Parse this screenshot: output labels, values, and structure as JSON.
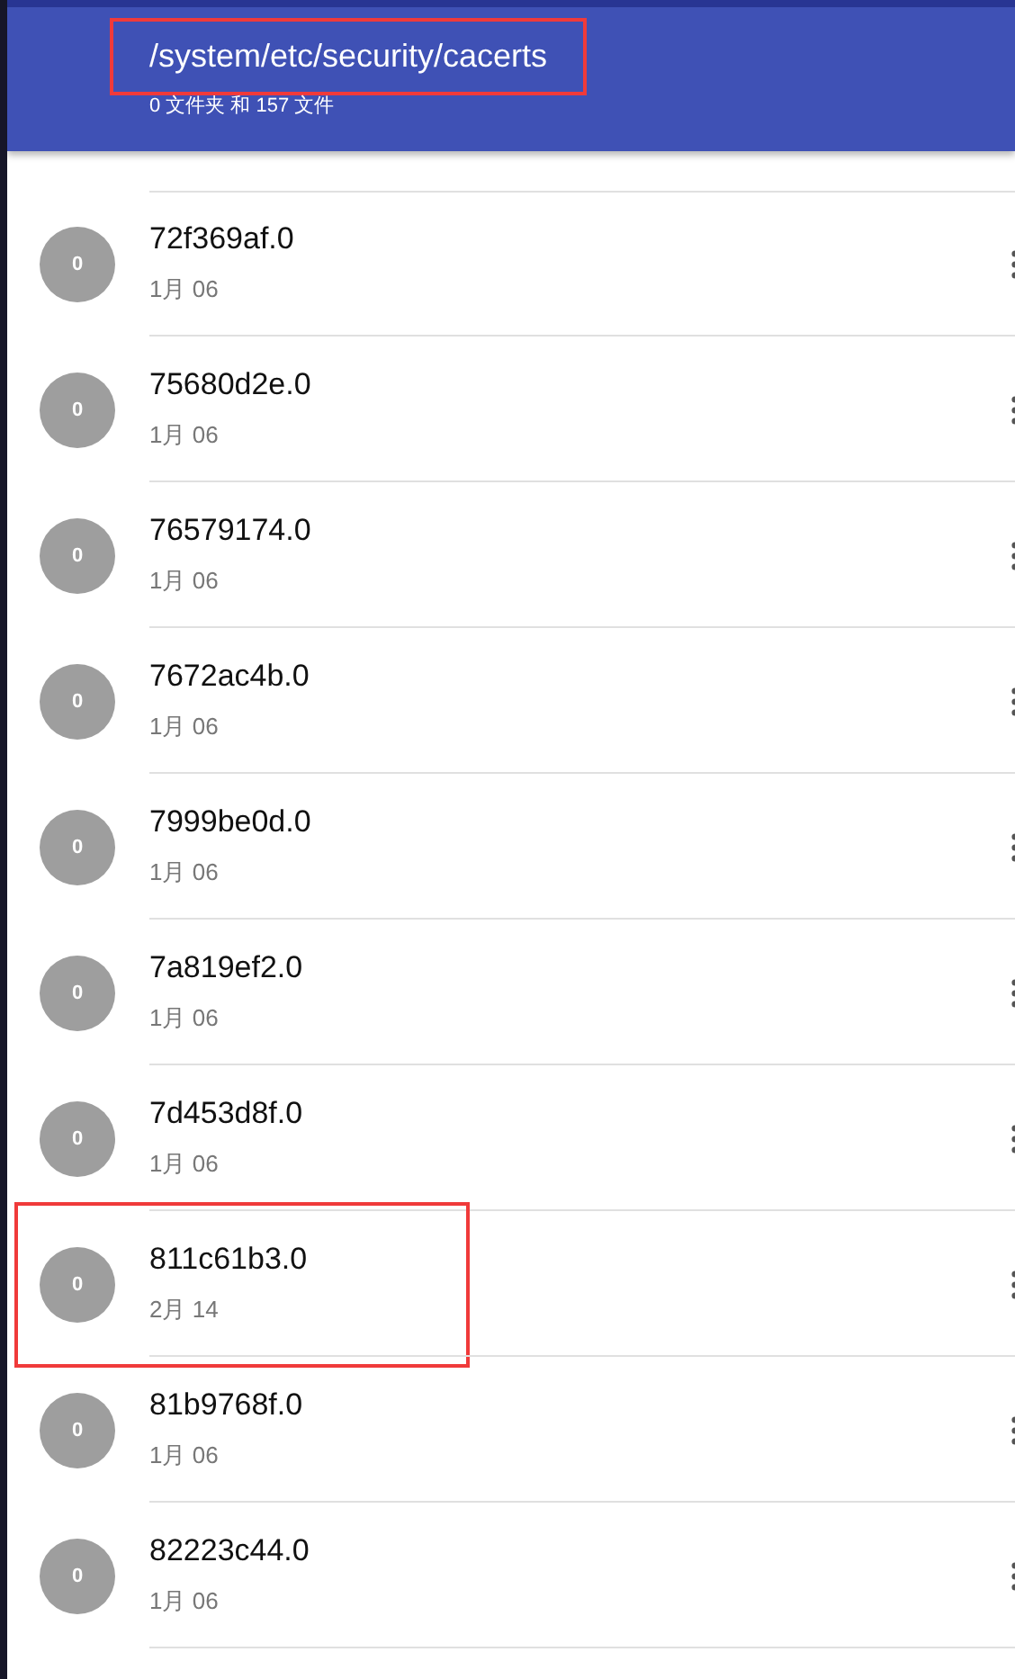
{
  "header": {
    "path": "/system/etc/security/cacerts",
    "path_highlighted": true,
    "summary": "0 文件夹 和 157 文件"
  },
  "files": [
    {
      "avatar": "0",
      "name": "72f369af.0",
      "date": "1月 06",
      "highlighted": false
    },
    {
      "avatar": "0",
      "name": "75680d2e.0",
      "date": "1月 06",
      "highlighted": false
    },
    {
      "avatar": "0",
      "name": "76579174.0",
      "date": "1月 06",
      "highlighted": false
    },
    {
      "avatar": "0",
      "name": "7672ac4b.0",
      "date": "1月 06",
      "highlighted": false
    },
    {
      "avatar": "0",
      "name": "7999be0d.0",
      "date": "1月 06",
      "highlighted": false
    },
    {
      "avatar": "0",
      "name": "7a819ef2.0",
      "date": "1月 06",
      "highlighted": false
    },
    {
      "avatar": "0",
      "name": "7d453d8f.0",
      "date": "1月 06",
      "highlighted": false
    },
    {
      "avatar": "0",
      "name": "811c61b3.0",
      "date": "2月 14",
      "highlighted": true
    },
    {
      "avatar": "0",
      "name": "81b9768f.0",
      "date": "1月 06",
      "highlighted": false
    },
    {
      "avatar": "0",
      "name": "82223c44.0",
      "date": "1月 06",
      "highlighted": false
    }
  ]
}
